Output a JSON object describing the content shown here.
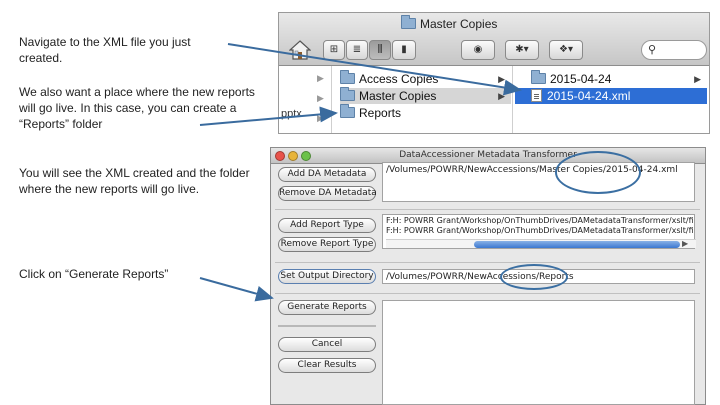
{
  "instructions": [
    "Navigate to the XML file you just created.",
    "We also want a place where the new reports will go live. In this case, you can create a “Reports” folder",
    "You will see the XML created and the folder where the new reports will go live.",
    "Click on “Generate Reports”"
  ],
  "finder": {
    "title": "Master Copies",
    "sidebar_partial_label": "pptx",
    "column1": [
      "Access Copies",
      "Master Copies",
      "Reports"
    ],
    "column2": [
      "2015-04-24",
      "2015-04-24.xml"
    ]
  },
  "app": {
    "title": "DataAccessioner Metadata Transformer",
    "buttons": {
      "add_da_metadata": "Add DA Metadata",
      "remove_da_metadata": "Remove DA Metadata",
      "add_report_type": "Add Report Type",
      "remove_report_type": "Remove Report Type",
      "set_output_directory": "Set Output Directory",
      "generate_reports": "Generate Reports",
      "cancel": "Cancel",
      "clear_results": "Clear Results"
    },
    "metadata_path": "/Volumes/POWRR/NewAccessions/Master Copies/2015-04-24.xml",
    "report_types": [
      "F:H: POWRR Grant/Workshop/OnThumbDrives/DAMetadataTransformer/xslt/files.csv.xslt",
      "F:H: POWRR Grant/Workshop/OnThumbDrives/DAMetadataTransformer/xslt/files.html.xslt"
    ],
    "output_directory": "/Volumes/POWRR/NewAccessions/Reports"
  }
}
